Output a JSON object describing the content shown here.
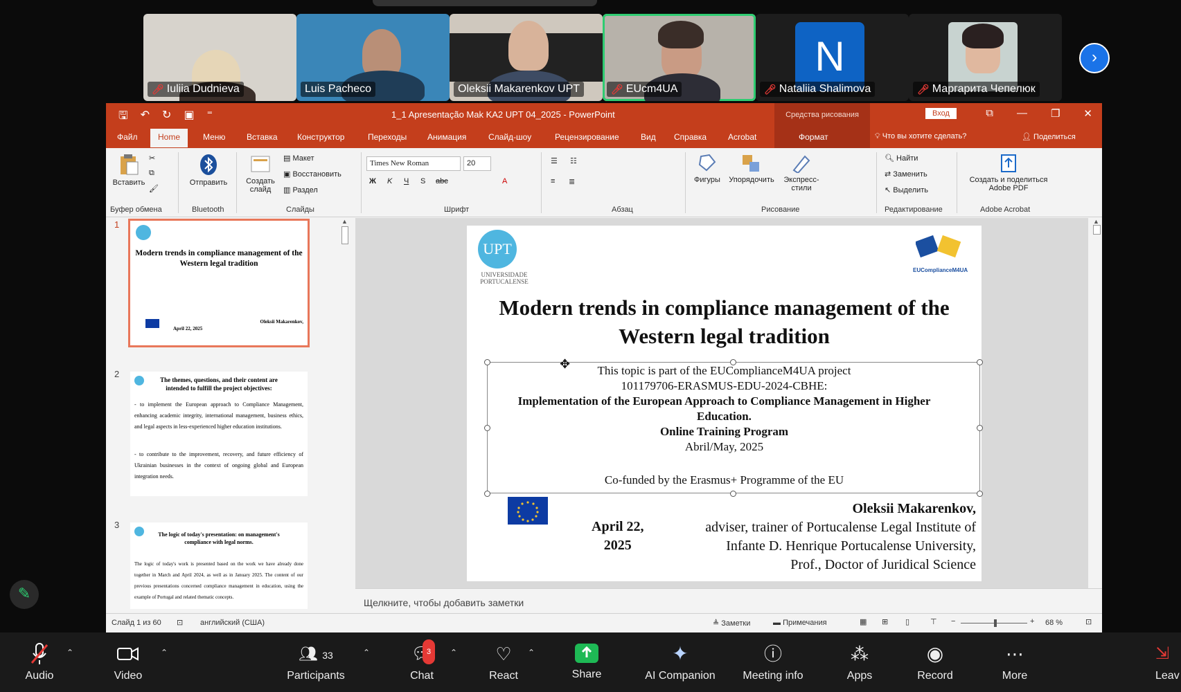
{
  "participants": [
    {
      "name": "Iuliia Dudnieva",
      "muted": true
    },
    {
      "name": "Luis Pacheco",
      "muted": false
    },
    {
      "name": "Oleksii Makarenkov UPT",
      "muted": false
    },
    {
      "name": "EUcm4UA",
      "muted": true,
      "active": true
    },
    {
      "name": "Nataliia Shalimova",
      "muted": true,
      "initial": "N"
    },
    {
      "name": "Маргарита Чепелюк",
      "muted": true
    }
  ],
  "powerpoint": {
    "doc_title": "1_1 Apresentação Mak KA2 UPT 04_2025  -  PowerPoint",
    "drawing_tools": "Средства рисования",
    "login": "Вход",
    "tabs": [
      "Файл",
      "Home",
      "Меню",
      "Вставка",
      "Конструктор",
      "Переходы",
      "Анимация",
      "Слайд-шоу",
      "Рецензирование",
      "Вид",
      "Справка",
      "Acrobat"
    ],
    "format_tab": "Формат",
    "tell_me": "Что вы хотите сделать?",
    "share": "Поделиться",
    "ribbon": {
      "paste": "Вставить",
      "send": "Отправить",
      "new_slide": "Создать слайд",
      "layout": "Макет",
      "reset": "Восстановить",
      "section": "Раздел",
      "font_name": "Times New Roman",
      "font_size": "20",
      "shapes": "Фигуры",
      "arrange": "Упорядочить",
      "quick_styles": "Экспресс-стили",
      "find": "Найти",
      "replace": "Заменить",
      "select": "Выделить",
      "create_share_pdf": "Создать и поделиться Adobe PDF",
      "groups": [
        "Буфер обмена",
        "Bluetooth",
        "Слайды",
        "Шрифт",
        "Абзац",
        "Рисование",
        "Редактирование",
        "Adobe Acrobat"
      ]
    },
    "thumbnails": [
      {
        "num": "1",
        "title": "Modern trends in compliance management of the Western legal tradition",
        "author": "Oleksii Makarenkov,",
        "date": "April 22, 2025"
      },
      {
        "num": "2",
        "title": "The themes, questions, and their content are intended to fulfill the project objectives:",
        "body": "- to implement the European approach to Compliance Management, enhancing academic integrity, international management, business ethics, and legal aspects in less-experienced higher education institutions.",
        "body2": "- to contribute to the improvement, recovery, and future efficiency of Ukrainian businesses in the context of ongoing global and European integration needs."
      },
      {
        "num": "3",
        "title": "The logic of today's presentation: on management's compliance with legal norms.",
        "body": "The logic of today's work is presented based on the work we have already done together in March and April 2024, as well as in January 2025. The content of our previous presentations concerned compliance management in education, using the example of Portugal and related thematic concepts."
      }
    ],
    "slide": {
      "upt_logo": "UPT",
      "university": "UNIVERSIDADE PORTUCALENSE",
      "partner_logo": "EUComplianceM4UA",
      "title_line1": "Modern trends in compliance management of the",
      "title_line2": "Western legal tradition",
      "line1": "This topic is part of the EUComplianceM4UA project",
      "line2": "101179706-ERASMUS-EDU-2024-CBHE:",
      "line3": "Implementation of the European Approach to Compliance Management in Higher",
      "line4": "Education.",
      "line5": "Online Training Program",
      "line6": "Abril/May, 2025",
      "line7": "Co-funded by the Erasmus+ Programme of the EU",
      "author": "Oleksii Makarenkov,",
      "author_l2": "adviser, trainer of Portucalense Legal Institute of",
      "author_l3": "Infante D. Henrique Portucalense University,",
      "author_l4": "Prof., Doctor of Juridical Science",
      "date_l1": "April 22,",
      "date_l2": "2025"
    },
    "notes_placeholder": "Щелкните, чтобы добавить заметки",
    "status": {
      "slide_counter": "Слайд 1 из 60",
      "language": "английский (США)",
      "notes": "Заметки",
      "comments": "Примечания",
      "zoom": "68 %"
    }
  },
  "zoom_toolbar": {
    "audio": "Audio",
    "video": "Video",
    "participants": "Participants",
    "participants_count": "33",
    "chat": "Chat",
    "chat_badge": "3",
    "react": "React",
    "share": "Share",
    "ai_companion": "AI Companion",
    "meeting_info": "Meeting info",
    "apps": "Apps",
    "record": "Record",
    "more": "More",
    "leave": "Leav"
  },
  "colors": {
    "ppt_accent": "#c43e1c",
    "active_speaker": "#2ecc71",
    "share_green": "#1eb955",
    "zoom_blue": "#1a73e8"
  }
}
